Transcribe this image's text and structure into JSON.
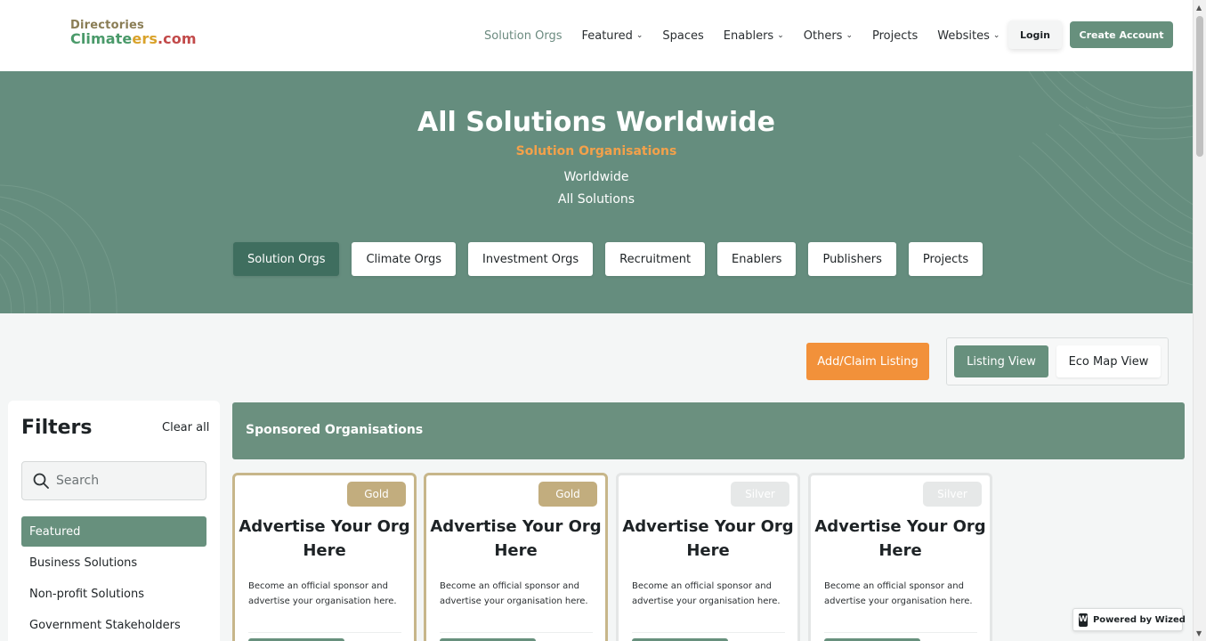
{
  "header": {
    "logo_top": "Directories",
    "logo_part1": "Climate",
    "logo_part2": "ers",
    "logo_part3": ".com",
    "nav": [
      {
        "label": "Solution Orgs",
        "dropdown": false,
        "active": true
      },
      {
        "label": "Featured",
        "dropdown": true
      },
      {
        "label": "Spaces",
        "dropdown": false
      },
      {
        "label": "Enablers",
        "dropdown": true
      },
      {
        "label": "Others",
        "dropdown": true
      },
      {
        "label": "Projects",
        "dropdown": false
      },
      {
        "label": "Websites",
        "dropdown": true
      }
    ],
    "login_label": "Login",
    "create_account_label": "Create Account"
  },
  "hero": {
    "title": "All Solutions Worldwide",
    "subtitle": "Solution Organisations",
    "line1": "Worldwide",
    "line2": "All Solutions",
    "tabs": [
      {
        "label": "Solution Orgs",
        "active": true
      },
      {
        "label": "Climate Orgs"
      },
      {
        "label": "Investment Orgs"
      },
      {
        "label": "Recruitment"
      },
      {
        "label": "Enablers"
      },
      {
        "label": "Publishers"
      },
      {
        "label": "Projects"
      }
    ]
  },
  "actions": {
    "add_claim_label": "Add/Claim Listing",
    "listing_view_label": "Listing View",
    "eco_map_view_label": "Eco Map View"
  },
  "filters": {
    "title": "Filters",
    "clear_all": "Clear all",
    "search_placeholder": "Search",
    "items": [
      {
        "label": "Featured",
        "active": true
      },
      {
        "label": "Business Solutions"
      },
      {
        "label": "Non-profit Solutions"
      },
      {
        "label": "Government Stakeholders"
      }
    ]
  },
  "sponsored": {
    "title": "Sponsored Organisations",
    "cards": [
      {
        "tier": "Gold",
        "title": "Advertise Your Org Here",
        "description": "Become an official sponsor and advertise your organisation here."
      },
      {
        "tier": "Gold",
        "title": "Advertise Your Org Here",
        "description": "Become an official sponsor and advertise your organisation here."
      },
      {
        "tier": "Silver",
        "title": "Advertise Your Org Here",
        "description": "Become an official sponsor and advertise your organisation here."
      },
      {
        "tier": "Silver",
        "title": "Advertise Your Org Here",
        "description": "Become an official sponsor and advertise your organisation here."
      }
    ]
  },
  "footer_badge": {
    "icon": "wized-logo-icon",
    "icon_glyph": "W",
    "label": "Powered by Wized"
  },
  "colors": {
    "brand_green": "#67907d",
    "hero_green": "#658d7e",
    "accent_orange": "#f2913a",
    "gold": "#c2ad7e",
    "silver": "#e6e8e8"
  }
}
